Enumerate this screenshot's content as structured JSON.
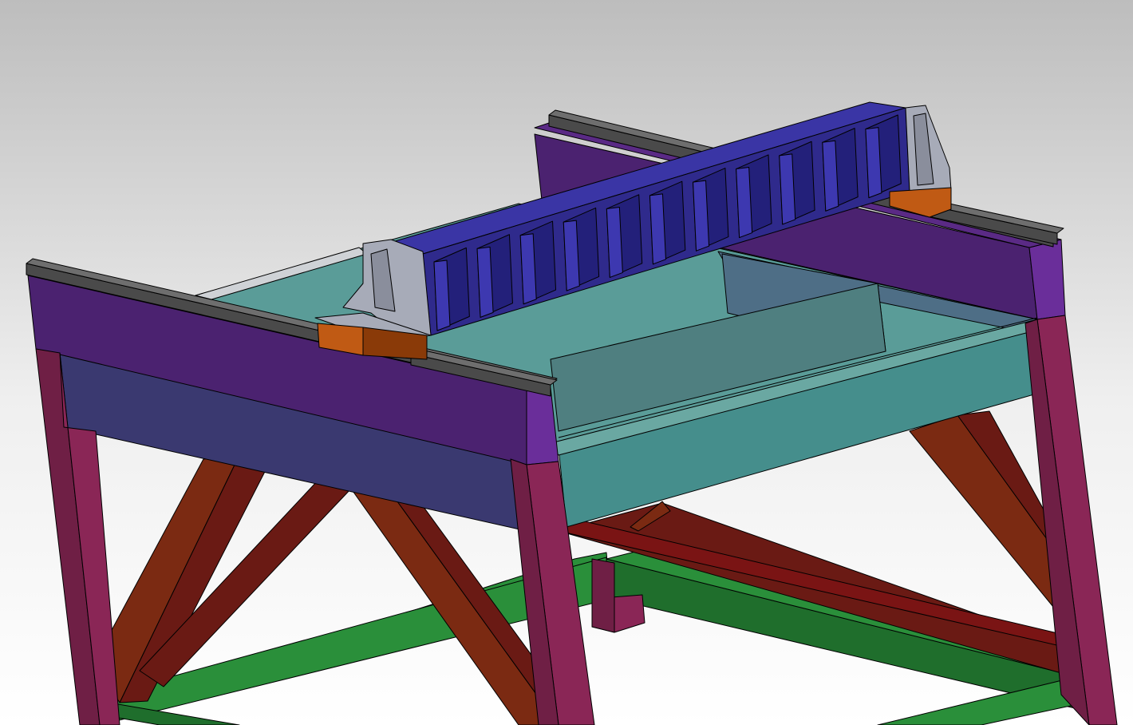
{
  "viewport": {
    "kind": "3D CAD model view",
    "background_gradient": [
      "#bdbdbd",
      "#efefef",
      "#ffffff"
    ]
  },
  "colors": {
    "rail": "#4a4a4a",
    "rail_top": "#6e6e6e",
    "top_beam_front": "#4b2270",
    "top_beam_end": "#6a2e9a",
    "side_panel": "#3a3970",
    "glass_front": "#458e8c",
    "glass_top": "#5a9c98",
    "glass_inner": "#4e6e86",
    "leg": "#8a2656",
    "leg_dark": "#6f1f45",
    "brace": "#7b2a12",
    "brace_dark": "#6a1a14",
    "bottom_frame": "#2a8f3a",
    "bottom_frame_dark": "#1f6e2c",
    "gantry_beam": "#2f2a8c",
    "gantry_cell": "#23207a",
    "gantry_top": "#3a35a5",
    "bracket": "#a7abb8",
    "bracket_dark": "#8a8e9c",
    "carriage": "#c05a14",
    "carriage_dark": "#8a3a08",
    "edge": "#000000"
  },
  "gantry": {
    "cell_count": 11
  },
  "rails": {
    "count": 4
  }
}
